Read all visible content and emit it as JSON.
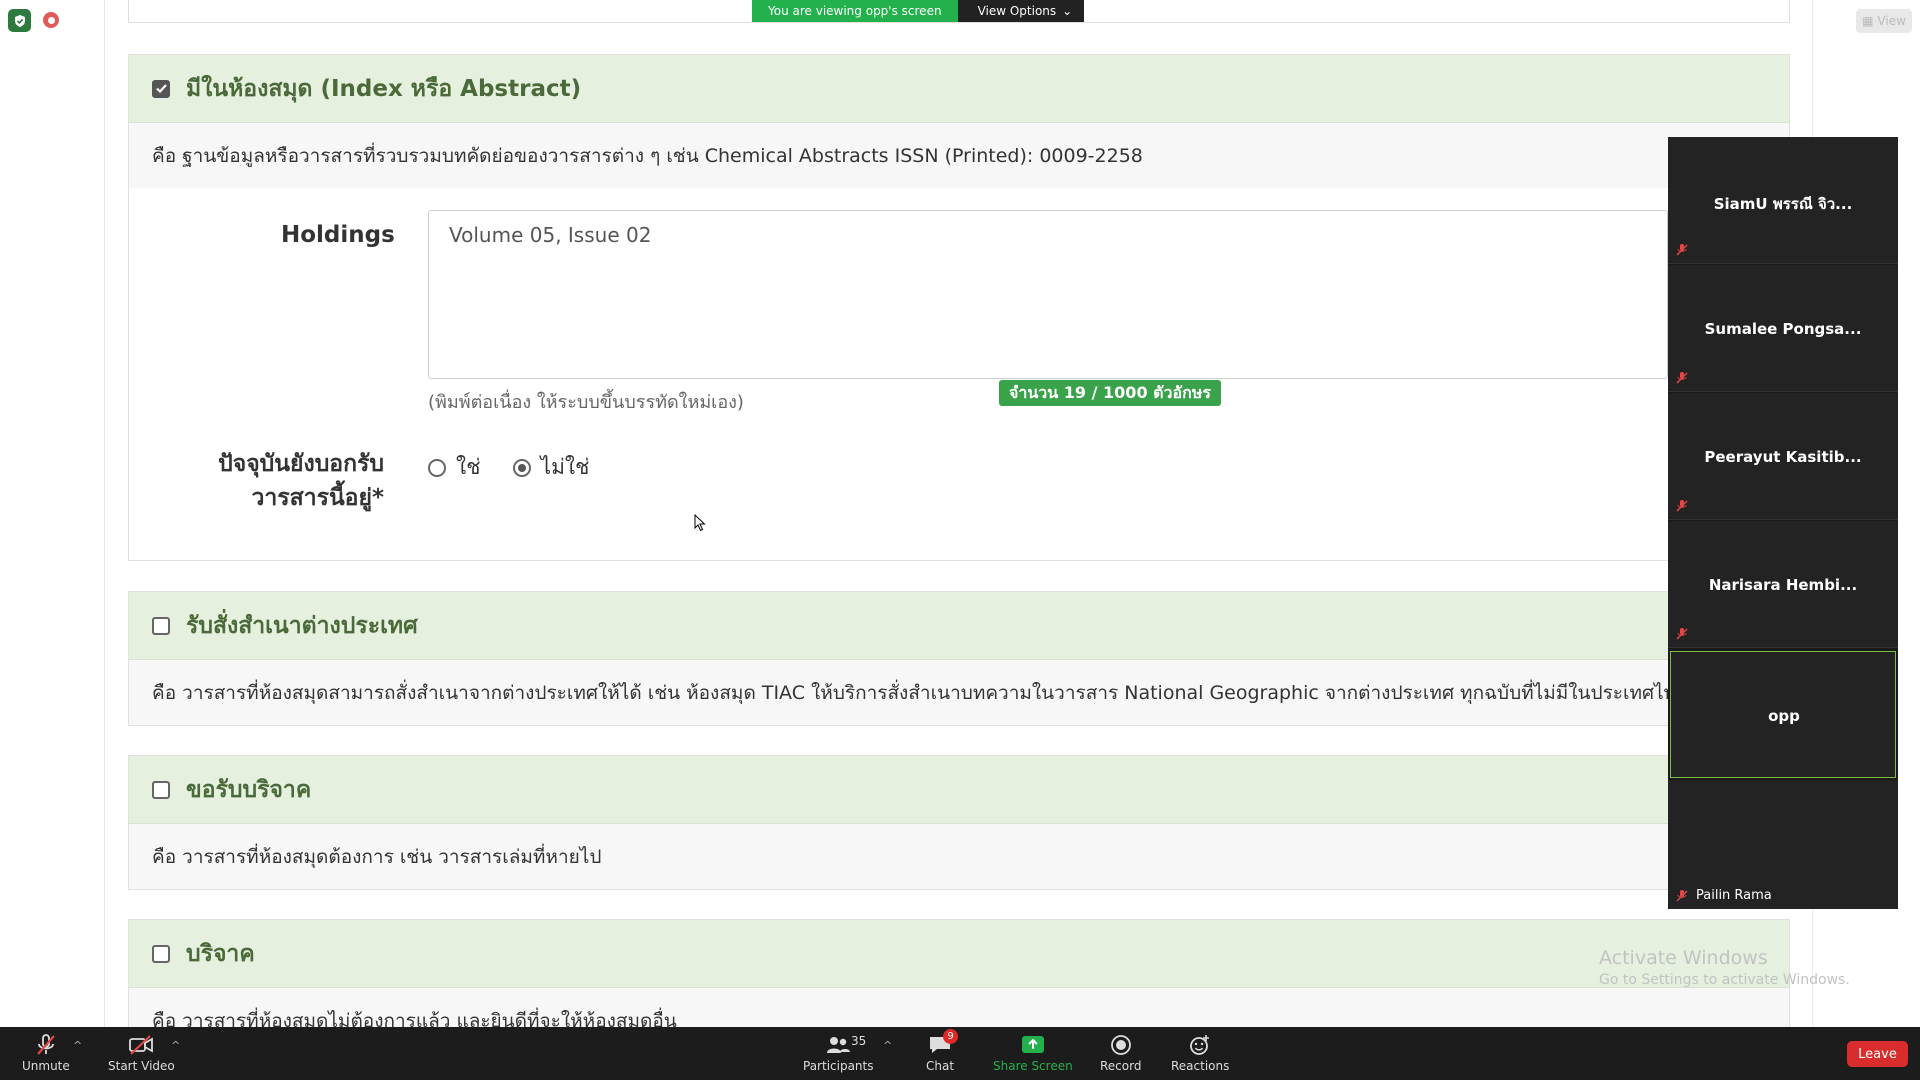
{
  "banner": {
    "viewing_text": "You are viewing opp's screen",
    "view_options_label": "View Options"
  },
  "top_right": {
    "view_label": "View"
  },
  "sections": [
    {
      "title": "มีในห้องสมุด (Index หรือ Abstract)",
      "checked": true,
      "description": "คือ ฐานข้อมูลหรือวารสารที่รวบรวมบทคัดย่อของวารสารต่าง ๆ เช่น Chemical Abstracts ISSN (Printed): 0009-2258"
    },
    {
      "title": "รับสั่งสำเนาต่างประเทศ",
      "checked": false,
      "description": "คือ วารสารที่ห้องสมุดสามารถสั่งสำเนาจากต่างประเทศให้ได้ เช่น ห้องสมุด TIAC ให้บริการสั่งสำเนาบทความในวารสาร National Geographic จากต่างประเทศ ทุกฉบับที่ไม่มีในประเทศไทย"
    },
    {
      "title": "ขอรับบริจาค",
      "checked": false,
      "description": "คือ วารสารที่ห้องสมุดต้องการ เช่น วารสารเล่มที่หายไป"
    },
    {
      "title": "บริจาค",
      "checked": false,
      "description": "คือ วารสารที่ห้องสมุดไม่ต้องการแล้ว และยินดีที่จะให้ห้องสมุดอื่น"
    }
  ],
  "holdings": {
    "label": "Holdings",
    "value": "Volume 05, Issue 02",
    "hint": "(พิมพ์ต่อเนื่อง ให้ระบบขึ้นบรรทัดใหม่เอง)",
    "counter": "จำนวน 19 / 1000 ตัวอักษร"
  },
  "subscription": {
    "label_line1": "ปัจจุบันยังบอกรับ",
    "label_line2": "วารสารนี้อยู่*",
    "options": [
      "ใช่",
      "ไม่ใช่"
    ],
    "selected": "ไม่ใช่"
  },
  "participants": [
    {
      "name": "SiamU พรรณี จิว..."
    },
    {
      "name": "Sumalee  Pongsa..."
    },
    {
      "name": "Peerayut  Kasitib..."
    },
    {
      "name": "Narisara  Hembi..."
    },
    {
      "name": "opp"
    },
    {
      "name": "Pailin Rama"
    }
  ],
  "watermark": {
    "title": "Activate Windows",
    "subtitle": "Go to Settings to activate Windows."
  },
  "toolbar": {
    "unmute": "Unmute",
    "start_video": "Start Video",
    "participants": "Participants",
    "participant_count": "35",
    "chat": "Chat",
    "chat_badge": "9",
    "share_screen": "Share Screen",
    "record": "Record",
    "reactions": "Reactions",
    "leave": "Leave"
  },
  "colors": {
    "section_header_bg": "#e6f0df",
    "section_title": "#4b6a3a",
    "counter_bg": "#3aa24a",
    "banner_green": "#22b14c",
    "leave_red": "#d92c2c"
  }
}
